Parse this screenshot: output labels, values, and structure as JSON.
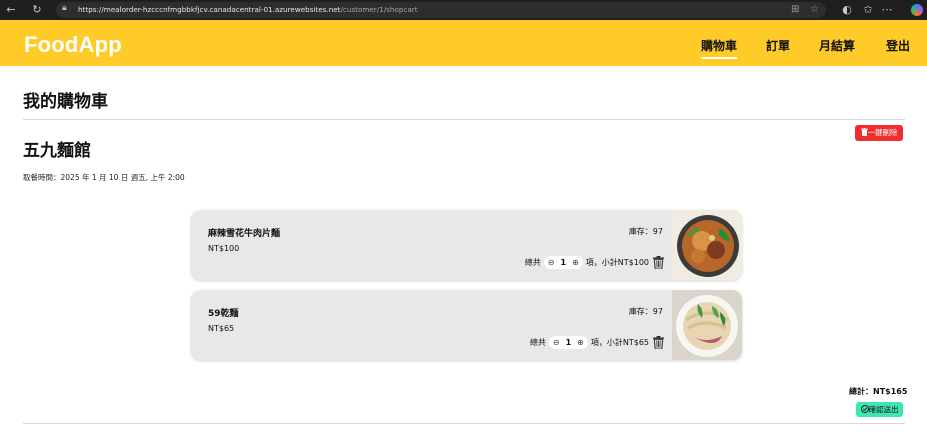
{
  "browser": {
    "url_host": "https://mealorder-hzcccnfmgbbkfjcv.canadacentral-01.azurewebsites.net",
    "url_path": "/customer/1/shopcart"
  },
  "nav": {
    "brand": "FoodApp",
    "items": [
      {
        "label": "購物車",
        "active": true
      },
      {
        "label": "訂單"
      },
      {
        "label": "月結算"
      },
      {
        "label": "登出"
      }
    ]
  },
  "page": {
    "title": "我的購物車",
    "delete_all_label": "一鍵刪除",
    "restaurant": "五九麵館",
    "pickup_time": "取餐時間：2025 年 1 月 10 日 週五, 上午 2:00",
    "items": [
      {
        "name": "麻辣雪花牛肉片麵",
        "price": "NT$100",
        "stock": "庫存：97",
        "qty_prefix": "總共",
        "qty": "1",
        "qty_suffix": "項，小計NT$100"
      },
      {
        "name": "59乾麵",
        "price": "NT$65",
        "stock": "庫存：97",
        "qty_prefix": "總共",
        "qty": "1",
        "qty_suffix": "項，小計NT$65"
      }
    ],
    "total": "總計：NT$165",
    "confirm_label": "確認送出"
  },
  "colors": {
    "nav_bg": "#ffcb29",
    "delete_bg": "#f02c2c",
    "confirm_bg": "#3ee6b4",
    "card_bg": "#e8e8e8"
  }
}
